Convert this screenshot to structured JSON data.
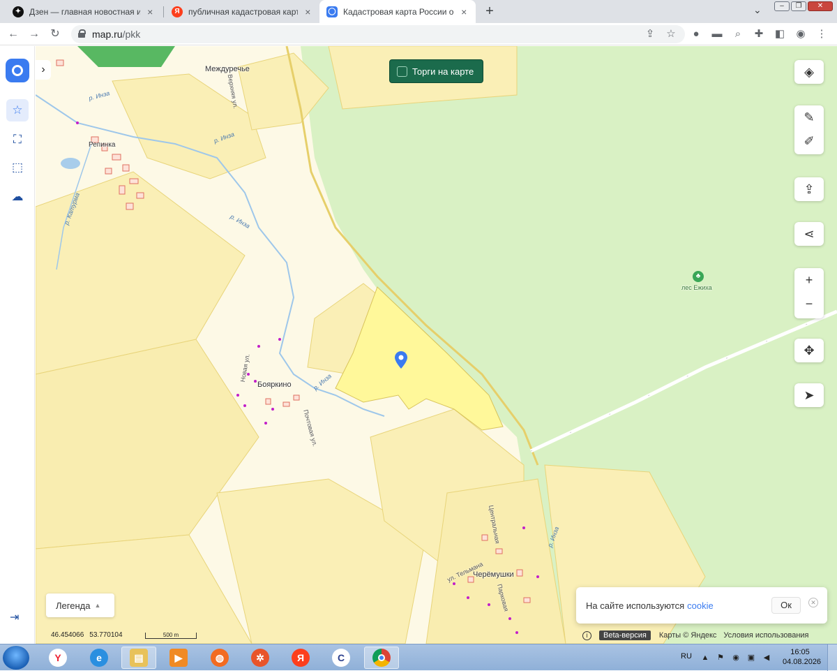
{
  "browser": {
    "tabs": [
      {
        "title": "Дзен — главная новостная инф"
      },
      {
        "title": "публичная кадастровая карта –"
      },
      {
        "title": "Кадастровая карта России онла"
      }
    ],
    "new_tab_label": "+",
    "url_domain": "map.ru",
    "url_path": "/pkk"
  },
  "map": {
    "torgi_label": "Торги на карте",
    "labels": {
      "mezhdureche": "Междуречье",
      "repinka": "Репинка",
      "boyarkino": "Бояркино",
      "cheremushki": "Черёмушки",
      "les_ezhikha": "лес Ежиха"
    },
    "streets": {
      "verkhnyaya": "Верхняя ул.",
      "novaya": "Новая ул.",
      "pochtovaya": "Почтовая ул.",
      "telmana": "ул. Тельмана",
      "parkovaya": "Парковая",
      "tsentralnaya": "Центральная"
    },
    "rivers": {
      "inza1": "р. Инза",
      "inza2": "р. Инза",
      "inza3": "р. Инза",
      "inza4": "р. Инза",
      "inza5": "р. Инза",
      "katurma": "р. Катурма"
    },
    "legend_label": "Легенда",
    "coords": {
      "lat": "46.454066",
      "lon": "53.770104"
    },
    "scale_label": "500 m",
    "cookie": {
      "text": "На сайте используются",
      "link": "cookie",
      "ok": "Ок"
    },
    "attribution": {
      "beta": "Beta-версия",
      "maps": "Карты © Яндекс",
      "terms": "Условия использования"
    }
  },
  "taskbar": {
    "lang": "RU",
    "time": "16:05",
    "date": "04.08.2026"
  },
  "colors": {
    "accent": "#3a7bf0",
    "torgi_bg": "#1b6b4c",
    "forest": "#d8f0c0",
    "field": "#fbf0b8",
    "parcel": "#fff59a"
  }
}
